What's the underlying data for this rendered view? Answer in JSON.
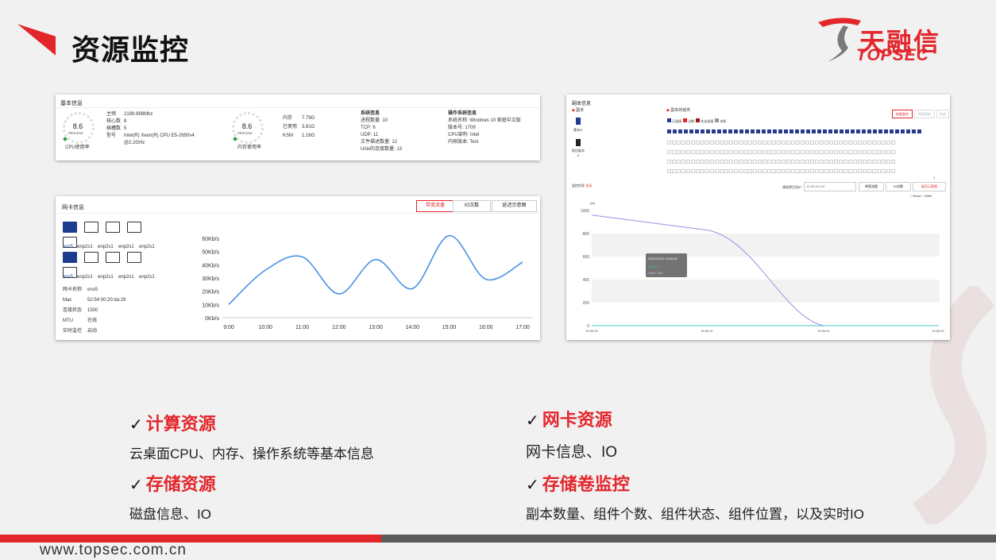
{
  "slide": {
    "title": "资源监控",
    "logo_cn": "天融信",
    "logo_en": "TOPSEC",
    "url": "www.topsec.com.cn",
    "accent_color": "#e3262c"
  },
  "basic_panel": {
    "title": "基本信息",
    "cpu_ring": {
      "value": "8.6",
      "unit": "PERCENT",
      "label": "CPU使用率"
    },
    "cpu_info": [
      {
        "k": "主频",
        "v": "2199.998Mhz"
      },
      {
        "k": "核心数",
        "v": "8"
      },
      {
        "k": "插槽数",
        "v": "5"
      },
      {
        "k": "型号",
        "v": "Intel(R) Xeon(R) CPU E5-2650v4"
      },
      {
        "k": "",
        "v": "@2.2GHz"
      }
    ],
    "mem_ring": {
      "value": "8.6",
      "unit": "PERCENT",
      "label": "内存使用率"
    },
    "mem_info": [
      {
        "k": "内存",
        "v": "7.79G"
      },
      {
        "k": "已使用",
        "v": "3.81G"
      },
      {
        "k": "KSM",
        "v": "1.16G"
      }
    ],
    "sys_title": "系统信息",
    "sys_info": [
      {
        "k": "进程数量:",
        "v": "10"
      },
      {
        "k": "TCP:",
        "v": "6"
      },
      {
        "k": "UDP:",
        "v": "11"
      },
      {
        "k": "文件描述数量:",
        "v": "12"
      },
      {
        "k": "Unix的连接数量:",
        "v": "13"
      }
    ],
    "os_title": "操作系统信息",
    "os_info": [
      {
        "k": "系统名称:",
        "v": "Windows 10 家庭中文版"
      },
      {
        "k": "版本号:",
        "v": "1709"
      },
      {
        "k": "CPU架构:",
        "v": "Intel"
      },
      {
        "k": "内核版本:",
        "v": "Test"
      }
    ]
  },
  "nic_panel": {
    "title": "网卡信息",
    "tabs": [
      "带宽流量",
      "IO次数",
      "延迟示意图"
    ],
    "nics_row1": [
      "ens5",
      "enp2s1",
      "enp2s1",
      "enp2s1",
      "enp2s1"
    ],
    "nics_row2": [
      "ens5",
      "enp2s1",
      "enp2s1",
      "enp2s1",
      "enp2s1"
    ],
    "details": [
      {
        "k": "网卡名称",
        "v": "ens5"
      },
      {
        "k": "Mac",
        "v": "52:54:00:20:da:29"
      },
      {
        "k": "连接状态",
        "v": "1500"
      },
      {
        "k": "MTU",
        "v": "在线"
      },
      {
        "k": "实时监控",
        "v": "启动"
      }
    ]
  },
  "storage_panel": {
    "title": "副本信息",
    "replica_label": "副本",
    "base_label": "基本①",
    "stale_label": "陈旧副本",
    "stale_count": "0",
    "components_title": "副本的组件",
    "legend": [
      "已连接",
      "过期",
      "失去连接",
      "未知"
    ],
    "buttons": [
      "恢复副本",
      "恢复数据",
      "恢复"
    ],
    "pager": "1",
    "monitor_label": "监控信息",
    "toggle_label": "关闭",
    "host_label": "请选择主机IP:",
    "host_value": "10.30.14.210",
    "tabs": [
      "带宽流量",
      "IO次数",
      "延迟示意图"
    ],
    "series_legend": [
      "Read",
      "Write"
    ],
    "y_unit": "(ul)",
    "tooltip": {
      "time": "2020-03-20 15:55:47",
      "read": "Read: 0",
      "write": "Write: 830"
    }
  },
  "bullets": [
    {
      "heading": "计算资源",
      "desc": "云桌面CPU、内存、操作系统等基本信息"
    },
    {
      "heading": "网卡资源",
      "desc": "网卡信息、IO"
    },
    {
      "heading": "存储资源",
      "desc": "磁盘信息、IO"
    },
    {
      "heading": "存储卷监控",
      "desc": "副本数量、组件个数、组件状态、组件位置，以及实时IO"
    }
  ],
  "chart_data": [
    {
      "type": "line",
      "x": [
        "9:00",
        "10:00",
        "11:00",
        "12:00",
        "13:00",
        "14:00",
        "15:00",
        "16:00",
        "17:00"
      ],
      "series": [
        {
          "values": [
            10,
            36,
            46,
            18,
            44,
            22,
            62,
            29,
            42
          ]
        }
      ],
      "ylabels": [
        "0Kb/s",
        "10Kb/s",
        "20Kb/s",
        "30Kb/s",
        "40Kb/s",
        "50Kb/s",
        "60Kb/s"
      ],
      "ylim": [
        0,
        60
      ],
      "line_color": "#4a90e2"
    },
    {
      "type": "line",
      "x": [
        "15:55:00",
        "15:55:41",
        "15:56:51",
        "15:56:52"
      ],
      "series": [
        {
          "name": "Read",
          "values": [
            0,
            0,
            0,
            0
          ]
        },
        {
          "name": "Write",
          "values": [
            960,
            830,
            0,
            0
          ]
        }
      ],
      "yticks": [
        "0",
        "200",
        "400",
        "600",
        "800",
        "1000"
      ],
      "ylim": [
        0,
        1000
      ],
      "read_color": "#41c8c8",
      "write_color": "#9b8fe0"
    }
  ]
}
